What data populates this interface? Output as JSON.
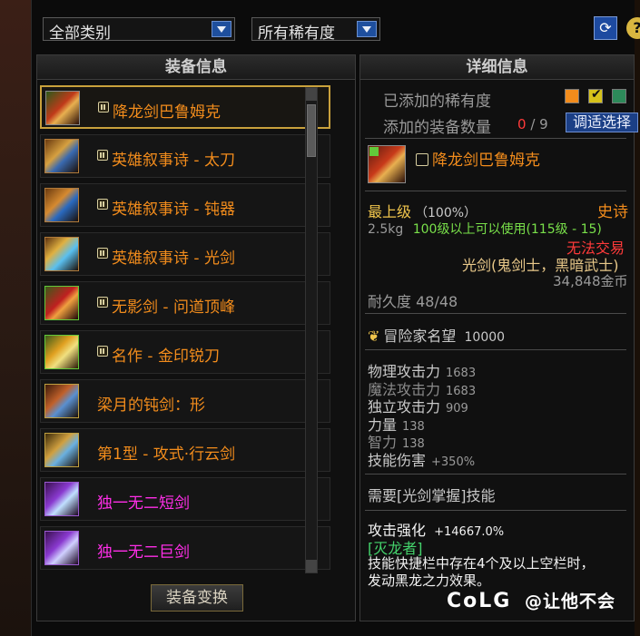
{
  "filters": {
    "category": "全部类别",
    "rarity": "所有稀有度"
  },
  "equipment_panel": {
    "title": "装备信息",
    "items": [
      {
        "name": "降龙剑巴鲁姆克",
        "locked": true,
        "color": "#f28c1c",
        "icon": "dragon-sword-icon",
        "selected": true
      },
      {
        "name": "英雄叙事诗 - 太刀",
        "locked": true,
        "color": "#f28c1c",
        "icon": "katana-icon"
      },
      {
        "name": "英雄叙事诗 - 钝器",
        "locked": true,
        "color": "#f28c1c",
        "icon": "blunt-weapon-icon"
      },
      {
        "name": "英雄叙事诗 - 光剑",
        "locked": true,
        "color": "#f28c1c",
        "icon": "lightsaber-icon"
      },
      {
        "name": "无影剑 - 问道顶峰",
        "locked": true,
        "color": "#f28c1c",
        "icon": "shadow-sword-icon"
      },
      {
        "name": "名作 - 金印锐刀",
        "locked": true,
        "color": "#f28c1c",
        "icon": "gold-blade-icon"
      },
      {
        "name": "梁月的钝剑：形",
        "locked": false,
        "color": "#f28c1c",
        "icon": "blunt-sword-icon"
      },
      {
        "name": "第1型 - 攻式·行云剑",
        "locked": false,
        "color": "#f28c1c",
        "icon": "cloud-sword-icon"
      },
      {
        "name": "独一无二短剑",
        "locked": false,
        "color": "#ff2ee8",
        "icon": "short-sword-icon"
      },
      {
        "name": "独一无二巨剑",
        "locked": false,
        "color": "#ff2ee8",
        "icon": "great-sword-icon"
      }
    ],
    "convert_button": "装备变换"
  },
  "detail_panel": {
    "title": "详细信息",
    "rarity_label": "已添加的稀有度",
    "rarity_colors": [
      "#f28c1c",
      "#d6c21a",
      "#2d8a5a"
    ],
    "count_label": "添加的装备数量",
    "count_current": "0",
    "count_sep": "/",
    "count_max": "9",
    "adjust_button": "调适选择",
    "item_name": "降龙剑巴鲁姆克",
    "grade": "最上级",
    "grade_pct": "（100%）",
    "rarity": "史诗",
    "weight": "2.5kg",
    "level_req": "100级以上可以使用(115级 - 15)",
    "untradable": "无法交易",
    "job": "光剑(鬼剑士，黑暗武士)",
    "price": "34,848金币",
    "durability": "耐久度 48/48",
    "reputation_label": "冒险家名望",
    "reputation_value": "10000",
    "stats": [
      {
        "label": "物理攻击力",
        "value": "1683"
      },
      {
        "label": "魔法攻击力",
        "value": "1683"
      },
      {
        "label": "独立攻击力",
        "value": "909"
      },
      {
        "label": "力量",
        "value": "138"
      },
      {
        "label": "智力",
        "value": "138"
      },
      {
        "label": "技能伤害",
        "value": "+350%"
      }
    ],
    "skill_req": "需要[光剑掌握]技能",
    "attack_enhance_label": "攻击强化",
    "attack_enhance_value": "+14667.0%",
    "set_name": "[灭龙者]",
    "desc_line1": "技能快捷栏中存在4个及以上空栏时，",
    "desc_line2": "发动黑龙之力效果。"
  },
  "watermark": {
    "brand": "CoLG",
    "author": "@让他不会"
  }
}
